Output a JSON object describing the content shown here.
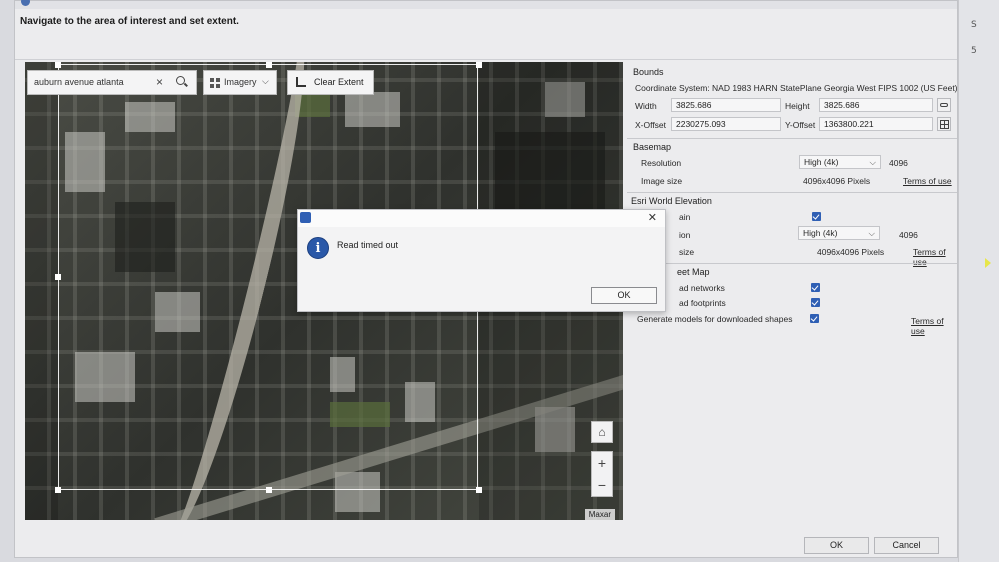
{
  "dialog": {
    "instruction": "Navigate to the area of interest and set extent."
  },
  "map": {
    "search": {
      "value": "auburn avenue atlanta",
      "clear_icon": "×"
    },
    "basemap_button": {
      "label": "Imagery",
      "chevron": "⌵"
    },
    "clear_extent_label": "Clear Extent",
    "home_icon": "⌂",
    "zoom_in": "+",
    "zoom_out": "−",
    "attribution": "Maxar"
  },
  "bounds": {
    "section": "Bounds",
    "coordinate_system": "Coordinate System: NAD 1983 HARN StatePlane Georgia West FIPS 1002 (US Feet)",
    "width_label": "Width",
    "width_value": "3825.686",
    "height_label": "Height",
    "height_value": "3825.686",
    "xoffset_label": "X-Offset",
    "xoffset_value": "2230275.093",
    "yoffset_label": "Y-Offset",
    "yoffset_value": "1363800.221"
  },
  "basemap": {
    "section": "Basemap",
    "resolution_label": "Resolution",
    "resolution_value": "High (4k)",
    "resolution_px": "4096",
    "image_size_label": "Image size",
    "image_size_value": "4096x4096 Pixels",
    "terms": "Terms of use"
  },
  "elevation": {
    "section": "Esri World Elevation",
    "terrain_label": "ain",
    "resolution_label": "ion",
    "resolution_value": "High (4k)",
    "resolution_px": "4096",
    "size_label": "size",
    "size_value": "4096x4096 Pixels",
    "terms": "Terms of use"
  },
  "streetmap": {
    "section": "eet Map",
    "road_networks": "ad networks",
    "footprints": "ad footprints",
    "generate_models": "Generate models for downloaded shapes",
    "terms": "Terms of use"
  },
  "error_dialog": {
    "message": "Read timed out",
    "ok_label": "OK",
    "close_icon": "✕",
    "info_glyph": "i"
  },
  "footer": {
    "ok_label": "OK",
    "cancel_label": "Cancel"
  },
  "right_edge": {
    "tick1": "S",
    "tick2": "5"
  }
}
